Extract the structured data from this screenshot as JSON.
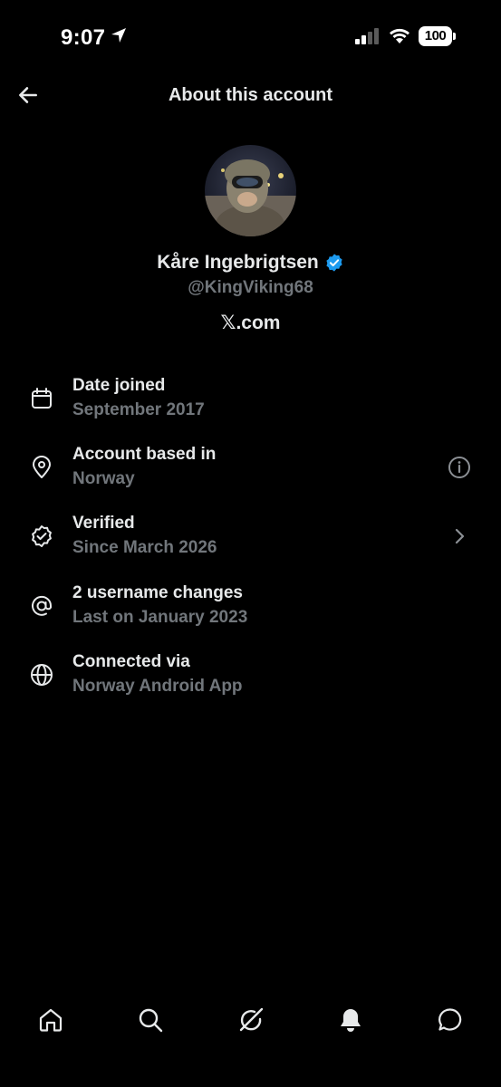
{
  "status_bar": {
    "time": "9:07",
    "battery": "100"
  },
  "header": {
    "title": "About this account"
  },
  "profile": {
    "name": "Kåre Ingebrigtsen",
    "handle": "@KingViking68",
    "site": "𝕏.com",
    "verified_color": "#1d9bf0"
  },
  "info": [
    {
      "icon": "calendar-icon",
      "title": "Date joined",
      "subtitle": "September 2017"
    },
    {
      "icon": "location-pin-icon",
      "title": "Account based in",
      "subtitle": "Norway",
      "action": "info-icon"
    },
    {
      "icon": "verified-badge-icon",
      "title": "Verified",
      "subtitle": "Since March 2026",
      "action": "chevron-right-icon"
    },
    {
      "icon": "at-sign-icon",
      "title": "2 username changes",
      "subtitle": "Last on January 2023"
    },
    {
      "icon": "globe-icon",
      "title": "Connected via",
      "subtitle": "Norway Android App"
    }
  ],
  "bottom_nav": [
    "home-icon",
    "search-icon",
    "grok-icon",
    "notifications-bell-icon",
    "messages-icon"
  ]
}
